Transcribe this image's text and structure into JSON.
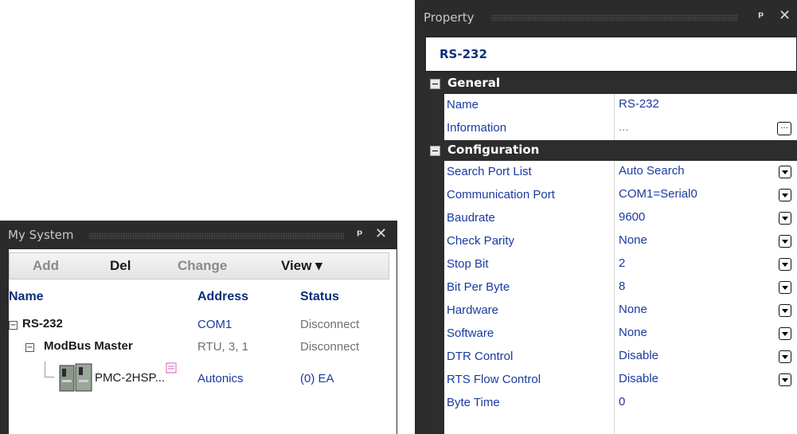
{
  "my_system": {
    "title": "My System",
    "toolbar": {
      "add": "Add",
      "del": "Del",
      "change": "Change",
      "view": "View ▾"
    },
    "columns": {
      "name": "Name",
      "address": "Address",
      "status": "Status"
    },
    "rows": [
      {
        "name": "RS-232",
        "address": "COM1",
        "status": "Disconnect"
      },
      {
        "name": "ModBus Master",
        "address": "RTU, 3, 1",
        "status": "Disconnect"
      },
      {
        "name": "PMC-2HSP...",
        "address": "Autonics",
        "status": "(0) EA"
      }
    ]
  },
  "property": {
    "title": "Property",
    "object_name": "RS-232",
    "categories": [
      {
        "label": "General",
        "items": [
          {
            "key": "Name",
            "value": "RS-232"
          },
          {
            "key": "Information",
            "value": "..."
          }
        ]
      },
      {
        "label": "Configuration",
        "items": [
          {
            "key": "Search Port List",
            "value": "Auto Search"
          },
          {
            "key": "Communication Port",
            "value": "COM1=Serial0"
          },
          {
            "key": "Baudrate",
            "value": "9600"
          },
          {
            "key": "Check Parity",
            "value": "None"
          },
          {
            "key": "Stop Bit",
            "value": "2"
          },
          {
            "key": "Bit Per Byte",
            "value": "8"
          },
          {
            "key": "Hardware",
            "value": "None"
          },
          {
            "key": "Software",
            "value": "None"
          },
          {
            "key": "DTR Control",
            "value": "Disable"
          },
          {
            "key": "RTS Flow Control",
            "value": "Disable"
          },
          {
            "key": "Byte Time",
            "value": "0"
          }
        ]
      }
    ]
  },
  "icons": {
    "pin": "pin-icon",
    "close": "close-icon",
    "device": "plc-module-icon",
    "note": "note-icon"
  },
  "colors": {
    "panel_bg": "#2b2b2b",
    "label_blue": "#1a3aa0",
    "header_blue": "#0b2f7a"
  }
}
